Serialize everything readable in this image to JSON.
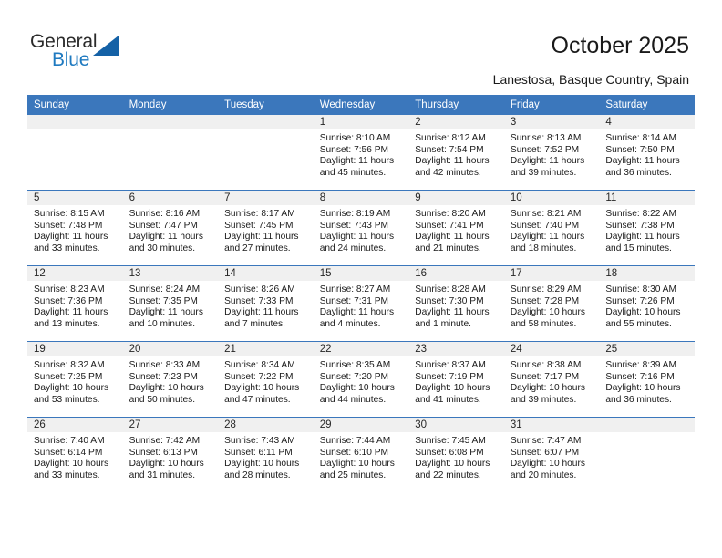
{
  "brand": {
    "name_part1": "General",
    "name_part2": "Blue",
    "logo_icon": "triangle-logo-icon",
    "accent_color": "#1f7ac0",
    "triangle_color": "#1461a6"
  },
  "header": {
    "title": "October 2025",
    "subtitle": "Lanestosa, Basque Country, Spain",
    "header_bg_color": "#3b77bc"
  },
  "weekday_headers": [
    "Sunday",
    "Monday",
    "Tuesday",
    "Wednesday",
    "Thursday",
    "Friday",
    "Saturday"
  ],
  "weeks": [
    [
      {
        "day": "",
        "lines": []
      },
      {
        "day": "",
        "lines": []
      },
      {
        "day": "",
        "lines": []
      },
      {
        "day": "1",
        "lines": [
          "Sunrise: 8:10 AM",
          "Sunset: 7:56 PM",
          "Daylight: 11 hours",
          "and 45 minutes."
        ]
      },
      {
        "day": "2",
        "lines": [
          "Sunrise: 8:12 AM",
          "Sunset: 7:54 PM",
          "Daylight: 11 hours",
          "and 42 minutes."
        ]
      },
      {
        "day": "3",
        "lines": [
          "Sunrise: 8:13 AM",
          "Sunset: 7:52 PM",
          "Daylight: 11 hours",
          "and 39 minutes."
        ]
      },
      {
        "day": "4",
        "lines": [
          "Sunrise: 8:14 AM",
          "Sunset: 7:50 PM",
          "Daylight: 11 hours",
          "and 36 minutes."
        ]
      }
    ],
    [
      {
        "day": "5",
        "lines": [
          "Sunrise: 8:15 AM",
          "Sunset: 7:48 PM",
          "Daylight: 11 hours",
          "and 33 minutes."
        ]
      },
      {
        "day": "6",
        "lines": [
          "Sunrise: 8:16 AM",
          "Sunset: 7:47 PM",
          "Daylight: 11 hours",
          "and 30 minutes."
        ]
      },
      {
        "day": "7",
        "lines": [
          "Sunrise: 8:17 AM",
          "Sunset: 7:45 PM",
          "Daylight: 11 hours",
          "and 27 minutes."
        ]
      },
      {
        "day": "8",
        "lines": [
          "Sunrise: 8:19 AM",
          "Sunset: 7:43 PM",
          "Daylight: 11 hours",
          "and 24 minutes."
        ]
      },
      {
        "day": "9",
        "lines": [
          "Sunrise: 8:20 AM",
          "Sunset: 7:41 PM",
          "Daylight: 11 hours",
          "and 21 minutes."
        ]
      },
      {
        "day": "10",
        "lines": [
          "Sunrise: 8:21 AM",
          "Sunset: 7:40 PM",
          "Daylight: 11 hours",
          "and 18 minutes."
        ]
      },
      {
        "day": "11",
        "lines": [
          "Sunrise: 8:22 AM",
          "Sunset: 7:38 PM",
          "Daylight: 11 hours",
          "and 15 minutes."
        ]
      }
    ],
    [
      {
        "day": "12",
        "lines": [
          "Sunrise: 8:23 AM",
          "Sunset: 7:36 PM",
          "Daylight: 11 hours",
          "and 13 minutes."
        ]
      },
      {
        "day": "13",
        "lines": [
          "Sunrise: 8:24 AM",
          "Sunset: 7:35 PM",
          "Daylight: 11 hours",
          "and 10 minutes."
        ]
      },
      {
        "day": "14",
        "lines": [
          "Sunrise: 8:26 AM",
          "Sunset: 7:33 PM",
          "Daylight: 11 hours",
          "and 7 minutes."
        ]
      },
      {
        "day": "15",
        "lines": [
          "Sunrise: 8:27 AM",
          "Sunset: 7:31 PM",
          "Daylight: 11 hours",
          "and 4 minutes."
        ]
      },
      {
        "day": "16",
        "lines": [
          "Sunrise: 8:28 AM",
          "Sunset: 7:30 PM",
          "Daylight: 11 hours",
          "and 1 minute."
        ]
      },
      {
        "day": "17",
        "lines": [
          "Sunrise: 8:29 AM",
          "Sunset: 7:28 PM",
          "Daylight: 10 hours",
          "and 58 minutes."
        ]
      },
      {
        "day": "18",
        "lines": [
          "Sunrise: 8:30 AM",
          "Sunset: 7:26 PM",
          "Daylight: 10 hours",
          "and 55 minutes."
        ]
      }
    ],
    [
      {
        "day": "19",
        "lines": [
          "Sunrise: 8:32 AM",
          "Sunset: 7:25 PM",
          "Daylight: 10 hours",
          "and 53 minutes."
        ]
      },
      {
        "day": "20",
        "lines": [
          "Sunrise: 8:33 AM",
          "Sunset: 7:23 PM",
          "Daylight: 10 hours",
          "and 50 minutes."
        ]
      },
      {
        "day": "21",
        "lines": [
          "Sunrise: 8:34 AM",
          "Sunset: 7:22 PM",
          "Daylight: 10 hours",
          "and 47 minutes."
        ]
      },
      {
        "day": "22",
        "lines": [
          "Sunrise: 8:35 AM",
          "Sunset: 7:20 PM",
          "Daylight: 10 hours",
          "and 44 minutes."
        ]
      },
      {
        "day": "23",
        "lines": [
          "Sunrise: 8:37 AM",
          "Sunset: 7:19 PM",
          "Daylight: 10 hours",
          "and 41 minutes."
        ]
      },
      {
        "day": "24",
        "lines": [
          "Sunrise: 8:38 AM",
          "Sunset: 7:17 PM",
          "Daylight: 10 hours",
          "and 39 minutes."
        ]
      },
      {
        "day": "25",
        "lines": [
          "Sunrise: 8:39 AM",
          "Sunset: 7:16 PM",
          "Daylight: 10 hours",
          "and 36 minutes."
        ]
      }
    ],
    [
      {
        "day": "26",
        "lines": [
          "Sunrise: 7:40 AM",
          "Sunset: 6:14 PM",
          "Daylight: 10 hours",
          "and 33 minutes."
        ]
      },
      {
        "day": "27",
        "lines": [
          "Sunrise: 7:42 AM",
          "Sunset: 6:13 PM",
          "Daylight: 10 hours",
          "and 31 minutes."
        ]
      },
      {
        "day": "28",
        "lines": [
          "Sunrise: 7:43 AM",
          "Sunset: 6:11 PM",
          "Daylight: 10 hours",
          "and 28 minutes."
        ]
      },
      {
        "day": "29",
        "lines": [
          "Sunrise: 7:44 AM",
          "Sunset: 6:10 PM",
          "Daylight: 10 hours",
          "and 25 minutes."
        ]
      },
      {
        "day": "30",
        "lines": [
          "Sunrise: 7:45 AM",
          "Sunset: 6:08 PM",
          "Daylight: 10 hours",
          "and 22 minutes."
        ]
      },
      {
        "day": "31",
        "lines": [
          "Sunrise: 7:47 AM",
          "Sunset: 6:07 PM",
          "Daylight: 10 hours",
          "and 20 minutes."
        ]
      },
      {
        "day": "",
        "lines": []
      }
    ]
  ]
}
